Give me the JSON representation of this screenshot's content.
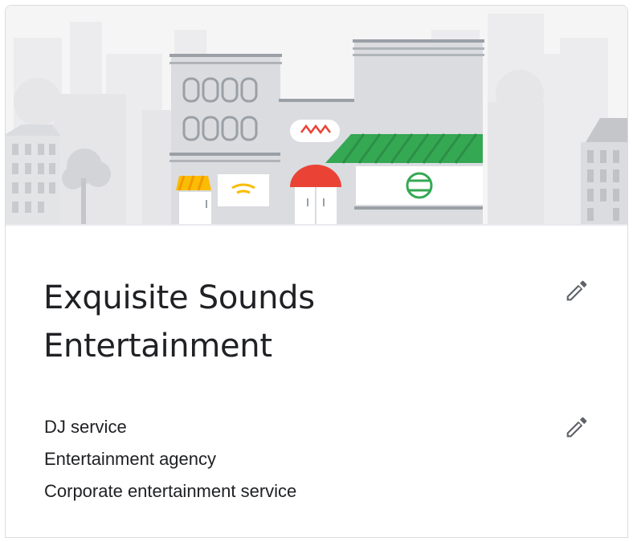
{
  "business": {
    "name_line1": "Exquisite Sounds",
    "name_line2": "Entertainment",
    "categories": [
      "DJ service",
      "Entertainment agency",
      "Corporate entertainment service"
    ]
  },
  "icons": {
    "edit_name": "pencil-icon",
    "edit_categories": "pencil-icon"
  },
  "colors": {
    "text": "#202124",
    "awning_green": "#34a853",
    "awning_red": "#ea4335",
    "awning_yellow": "#fbbc04",
    "building_grey": "#bdc1c6",
    "icon_grey": "#5f6368"
  }
}
